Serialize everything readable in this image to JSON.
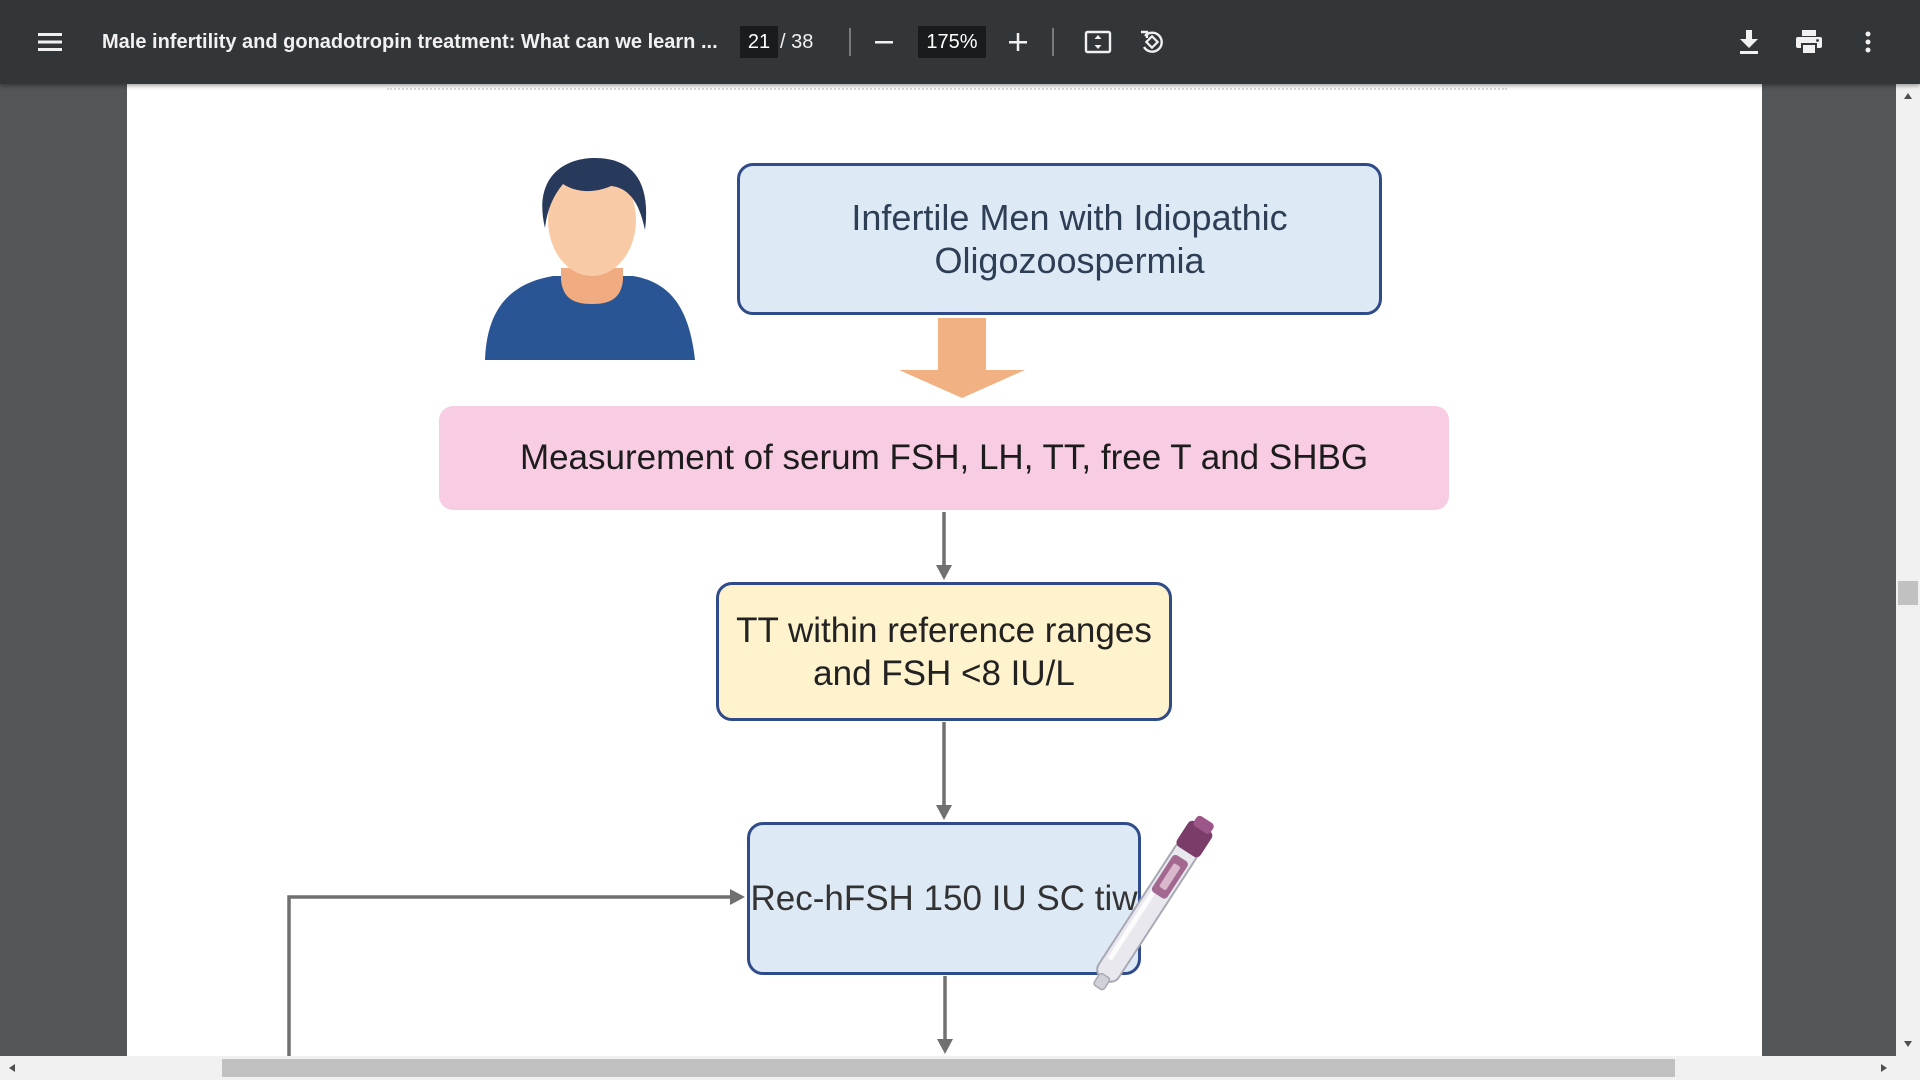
{
  "toolbar": {
    "title": "Male infertility and gonadotropin treatment: What can we learn ...",
    "current_page": "21",
    "page_separator": "/ 38",
    "zoom": "175%"
  },
  "diagram": {
    "box_infertile": "Infertile Men with Idiopathic Oligozoospermia",
    "box_measurement": "Measurement of serum FSH, LH, TT, free T and SHBG",
    "box_tt": "TT within reference ranges and FSH <8 IU/L",
    "box_fsh": "Rec-hFSH 150 IU SC tiw"
  },
  "colors": {
    "toolbar_bg": "#323639",
    "viewer_bg": "#525659",
    "box_blue": "#dee9f6",
    "box_pink": "#f8cde3",
    "box_yellow": "#fef3cd",
    "box_border": "#2f4b8a",
    "arrow_orange": "#f2b183",
    "arrow_gray": "#707070"
  }
}
